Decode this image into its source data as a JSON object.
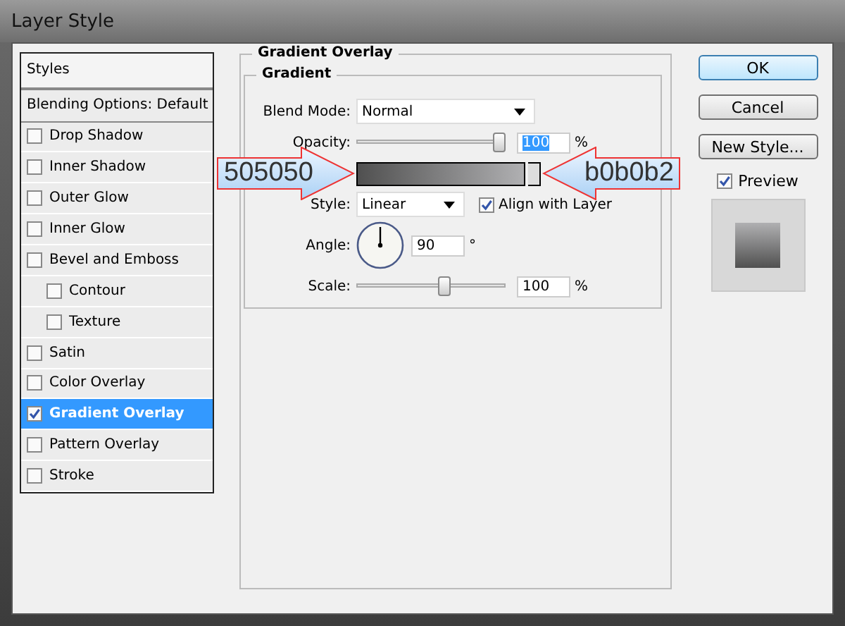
{
  "window": {
    "title": "Layer Style"
  },
  "styles_list": {
    "heading": "Styles",
    "blending_options": "Blending Options: Default",
    "items": [
      {
        "label": "Drop Shadow",
        "checked": false,
        "selected": false
      },
      {
        "label": "Inner Shadow",
        "checked": false,
        "selected": false
      },
      {
        "label": "Outer Glow",
        "checked": false,
        "selected": false
      },
      {
        "label": "Inner Glow",
        "checked": false,
        "selected": false
      },
      {
        "label": "Bevel and Emboss",
        "checked": false,
        "selected": false,
        "children": [
          {
            "label": "Contour",
            "checked": false,
            "selected": false
          },
          {
            "label": "Texture",
            "checked": false,
            "selected": false
          }
        ]
      },
      {
        "label": "Satin",
        "checked": false,
        "selected": false
      },
      {
        "label": "Color Overlay",
        "checked": false,
        "selected": false
      },
      {
        "label": "Gradient Overlay",
        "checked": true,
        "selected": true
      },
      {
        "label": "Pattern Overlay",
        "checked": false,
        "selected": false
      },
      {
        "label": "Stroke",
        "checked": false,
        "selected": false
      }
    ]
  },
  "gradient_overlay": {
    "title": "Gradient Overlay",
    "group_title": "Gradient",
    "blend_mode": {
      "label": "Blend Mode:",
      "value": "Normal"
    },
    "opacity": {
      "label": "Opacity:",
      "level": 1,
      "value": "100",
      "unit": "%"
    },
    "gradient": {
      "stops": [
        {
          "color": "#505050"
        },
        {
          "color": "#b0b0b2"
        }
      ]
    },
    "style": {
      "label": "Style:",
      "value": "Linear"
    },
    "align_with_layer": {
      "label": "Align with Layer",
      "checked": true
    },
    "angle": {
      "label": "Angle:",
      "value": "90",
      "unit": "°"
    },
    "scale": {
      "label": "Scale:",
      "level": 0.6,
      "value": "100",
      "unit": "%"
    }
  },
  "buttons": [
    {
      "label": "OK",
      "kind": "default"
    },
    {
      "label": "Cancel",
      "kind": "normal"
    },
    {
      "label": "New Style...",
      "kind": "normal"
    }
  ],
  "preview": {
    "label": "Preview",
    "checked": true
  },
  "callouts": [
    {
      "text": "505050",
      "kind": "rightward"
    },
    {
      "text": "b0b0b2",
      "kind": "leftward"
    }
  ]
}
